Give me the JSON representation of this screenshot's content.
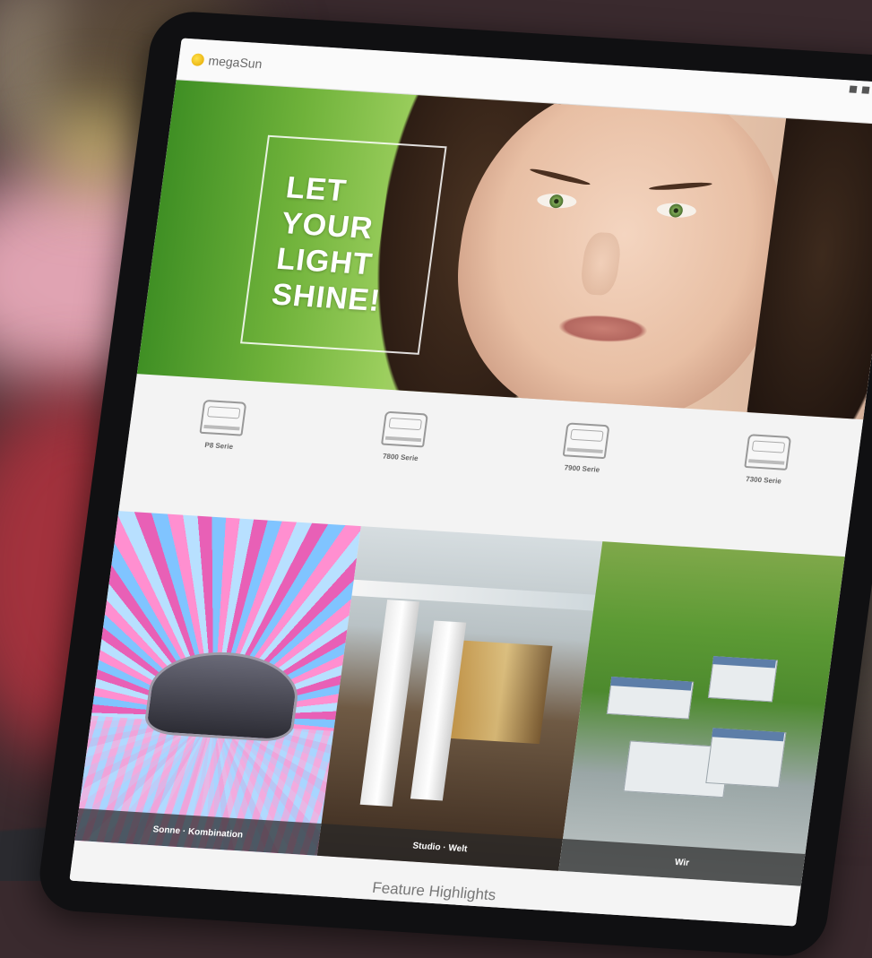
{
  "site": {
    "logo_text": "megaSun",
    "nav_items": [
      "",
      "",
      "",
      "",
      "",
      "",
      ""
    ],
    "search_icon": "search-icon"
  },
  "hero": {
    "tagline": [
      "LET",
      "YOUR",
      "LIGHT",
      "SHINE!"
    ]
  },
  "series": [
    {
      "name": "P8 Serie",
      "icon": "tanning-bed-icon"
    },
    {
      "name": "7800 Serie",
      "icon": "tanning-bed-icon"
    },
    {
      "name": "7900 Serie",
      "icon": "tanning-bed-icon"
    },
    {
      "name": "7300 Serie",
      "icon": "tanning-bed-icon"
    }
  ],
  "gallery": [
    {
      "caption": "Sonne · Kombination"
    },
    {
      "caption": "Studio · Welt"
    },
    {
      "caption": "Wir"
    }
  ],
  "feature": {
    "title": "Feature Highlights"
  },
  "colors": {
    "logo_accent": "#f0b400",
    "hero_green": "#6fb23a",
    "caption_bar": "#3a3a3a"
  }
}
